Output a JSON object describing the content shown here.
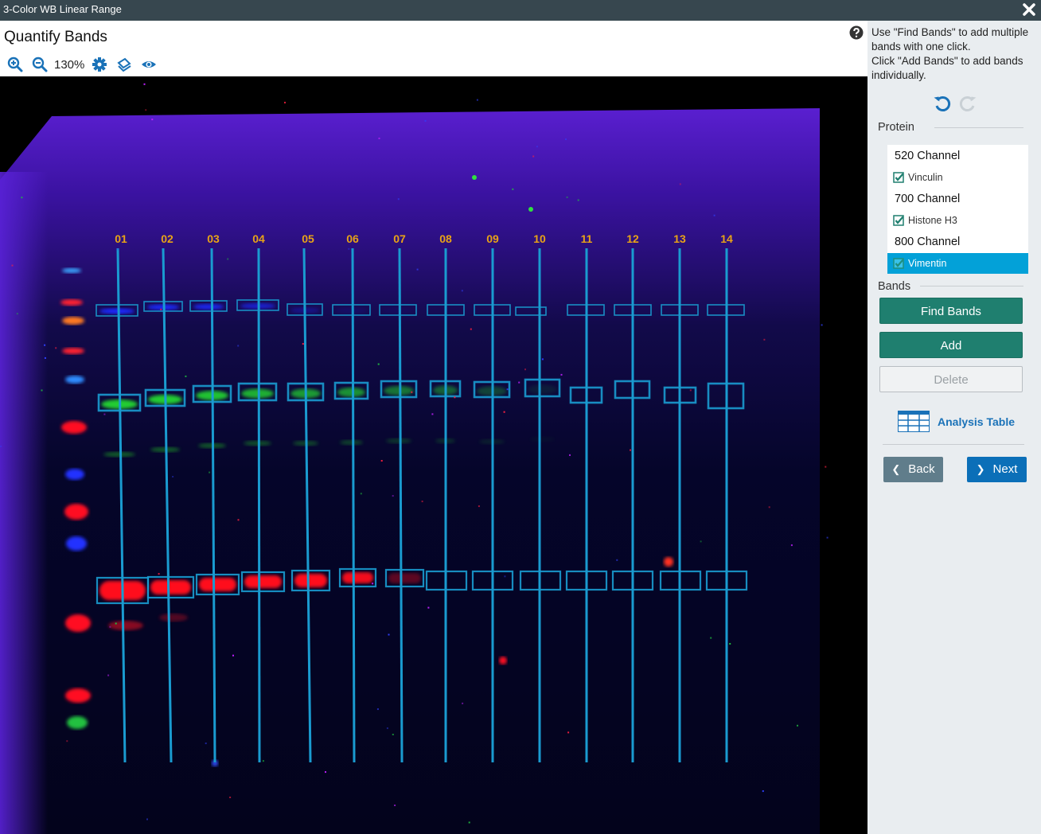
{
  "window": {
    "title": "3-Color WB Linear Range"
  },
  "header": {
    "title": "Quantify Bands",
    "zoom_level": "130%"
  },
  "toolbar": {
    "icons": [
      "zoom-in-icon",
      "zoom-out-icon",
      "gear-icon",
      "layers-icon",
      "eye-icon"
    ]
  },
  "help": {
    "line1": "Use \"Find Bands\" to add multiple bands with one click.",
    "line2": "Click \"Add Bands\" to add bands individually."
  },
  "protein": {
    "label": "Protein",
    "channels": [
      {
        "name": "520 Channel",
        "protein": "Vinculin",
        "checked": true,
        "selected": false
      },
      {
        "name": "700 Channel",
        "protein": "Histone H3",
        "checked": true,
        "selected": false
      },
      {
        "name": "800 Channel",
        "protein": "Vimentin",
        "checked": true,
        "selected": true
      }
    ]
  },
  "bands": {
    "label": "Bands",
    "find_bands": "Find Bands",
    "add": "Add",
    "delete": "Delete",
    "analysis_table": "Analysis Table"
  },
  "nav": {
    "back": "Back",
    "next": "Next"
  },
  "colors": {
    "accent_teal": "#1f7f6f",
    "selection_blue": "#03a1d8",
    "next_blue": "#0b6fb8",
    "back_gray": "#607d8b",
    "lane_line": "#1a9bd0",
    "lane_label": "#e8a317"
  },
  "gel": {
    "lanes": [
      "01",
      "02",
      "03",
      "04",
      "05",
      "06",
      "07",
      "08",
      "09",
      "10",
      "11",
      "12",
      "13",
      "14"
    ],
    "channels": [
      "520 Channel",
      "700 Channel",
      "800 Channel"
    ]
  }
}
